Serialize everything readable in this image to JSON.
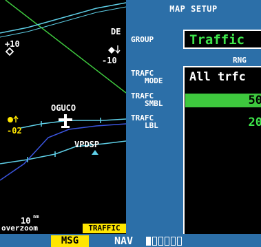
{
  "map": {
    "waypoint_de": "DE",
    "alt_plus10": "+10",
    "alt_minus10": "-10",
    "waypoint_oguco": "OGUCO",
    "alt_minus02": "-02",
    "waypoint_vpdsp": "VPDSP",
    "scale_value": "10",
    "scale_unit": "nm",
    "overzoom_label": "overzoom",
    "traffic_badge": "TRAFFIC"
  },
  "panel": {
    "title": "MAP SETUP",
    "group_label": "GROUP",
    "group_value": "Traffic",
    "rng_header": "RNG",
    "traffic_mode_label_1": "TRAFC",
    "traffic_mode_label_2": "MODE",
    "traffic_mode_value": "All trfc",
    "traffic_symbol_label_1": "TRAFC",
    "traffic_symbol_label_2": "SMBL",
    "traffic_symbol_value": "50",
    "traffic_label_label_1": "TRAFC",
    "traffic_label_label_2": "LBL",
    "traffic_label_value": "20"
  },
  "status": {
    "msg": "MSG",
    "nav": "NAV"
  },
  "colors": {
    "panel_blue": "#2c6fa8",
    "value_green": "#3ee44a",
    "alert_yellow": "#ffe600",
    "route_cyan": "#5fd0e8"
  }
}
